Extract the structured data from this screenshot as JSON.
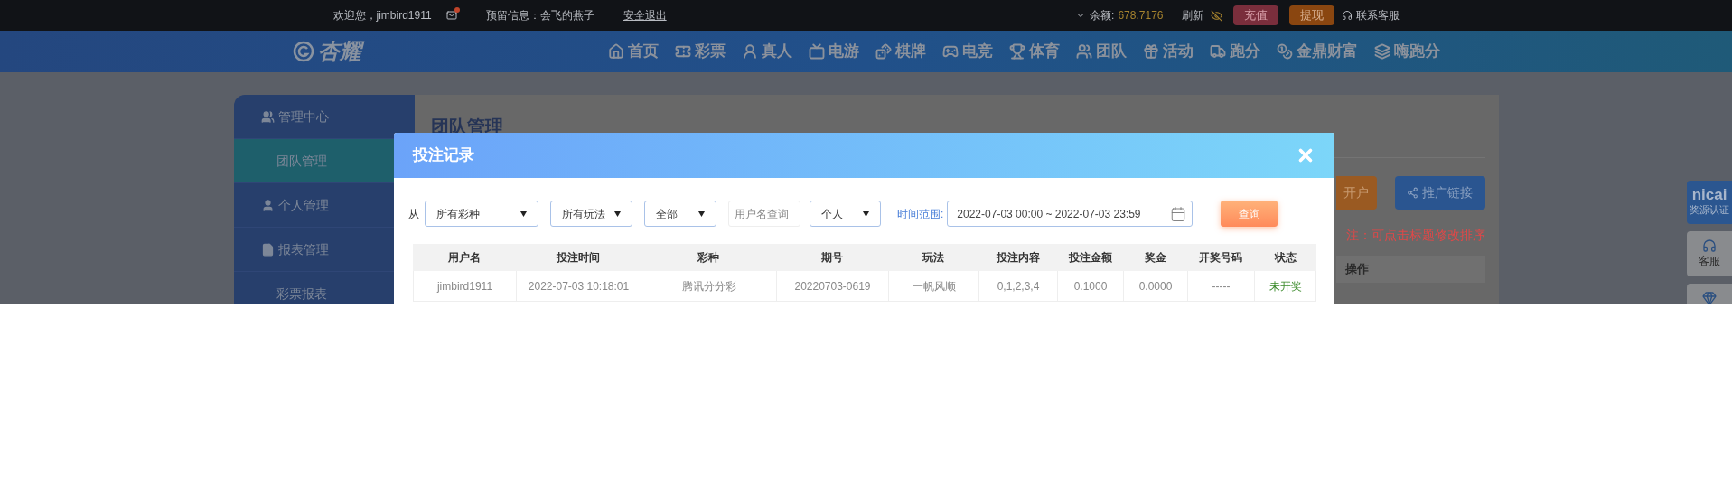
{
  "top_bar": {
    "greeting": "欢迎您，jimbird1911",
    "unread": true,
    "reserved_message": "预留信息：会飞的燕子",
    "logout": "安全退出",
    "balance_label": "余额:",
    "balance": "678.7176",
    "refresh": "刷新",
    "buttons": [
      {
        "label": "充值",
        "kind": "deposit"
      },
      {
        "label": "提现",
        "kind": "withdraw"
      }
    ],
    "support": "联系客服"
  },
  "nav": {
    "logo": "杏耀",
    "items": [
      "首页",
      "彩票",
      "真人",
      "电游",
      "棋牌",
      "电竞",
      "体育",
      "团队",
      "活动",
      "跑分",
      "金鼎财富",
      "嗨跑分"
    ]
  },
  "sidebar": {
    "items": [
      {
        "label": "管理中心",
        "kind": "section",
        "selected": false
      },
      {
        "label": "团队管理",
        "kind": "sub",
        "selected": true
      },
      {
        "label": "个人管理",
        "kind": "section",
        "selected": false
      },
      {
        "label": "报表管理",
        "kind": "section",
        "selected": false
      },
      {
        "label": "彩票报表",
        "kind": "sub",
        "selected": false
      }
    ]
  },
  "panel": {
    "title": "团队管理",
    "buttons": [
      {
        "label": "开户",
        "kind": "orange"
      },
      {
        "label": "推广链接",
        "kind": "blue"
      }
    ],
    "note": "注：可点击标题修改排序",
    "table_columns": [
      "操作"
    ]
  },
  "side_float": [
    {
      "kind": "badge",
      "logo": "nicai",
      "label": "奖源认证"
    },
    {
      "kind": "support",
      "label": "客服"
    },
    {
      "kind": "diamond"
    }
  ],
  "modal": {
    "title": "投注记录",
    "filters": [
      {
        "kind": "label",
        "text": "从"
      },
      {
        "kind": "select",
        "value": "所有彩种"
      },
      {
        "kind": "select",
        "value": "所有玩法"
      },
      {
        "kind": "select",
        "value": "全部"
      },
      {
        "kind": "input",
        "placeholder": "用户名查询"
      },
      {
        "kind": "select",
        "value": "个人"
      },
      {
        "kind": "accent_label",
        "text": "时间范围:"
      },
      {
        "kind": "date",
        "value": "2022-07-03 00:00 ~ 2022-07-03 23:59"
      },
      {
        "kind": "button",
        "text": "查询"
      }
    ],
    "table": {
      "columns": [
        "用户名",
        "投注时间",
        "彩种",
        "期号",
        "玩法",
        "投注内容",
        "投注金额",
        "奖金",
        "开奖号码",
        "状态"
      ],
      "rows": [
        [
          "jimbird1911",
          "2022-07-03 10:18:01",
          "腾讯分分彩",
          "20220703-0619",
          "一帆风顺",
          "0,1,2,3,4",
          "0.1000",
          "0.0000",
          "-----",
          "未开奖"
        ]
      ]
    }
  }
}
